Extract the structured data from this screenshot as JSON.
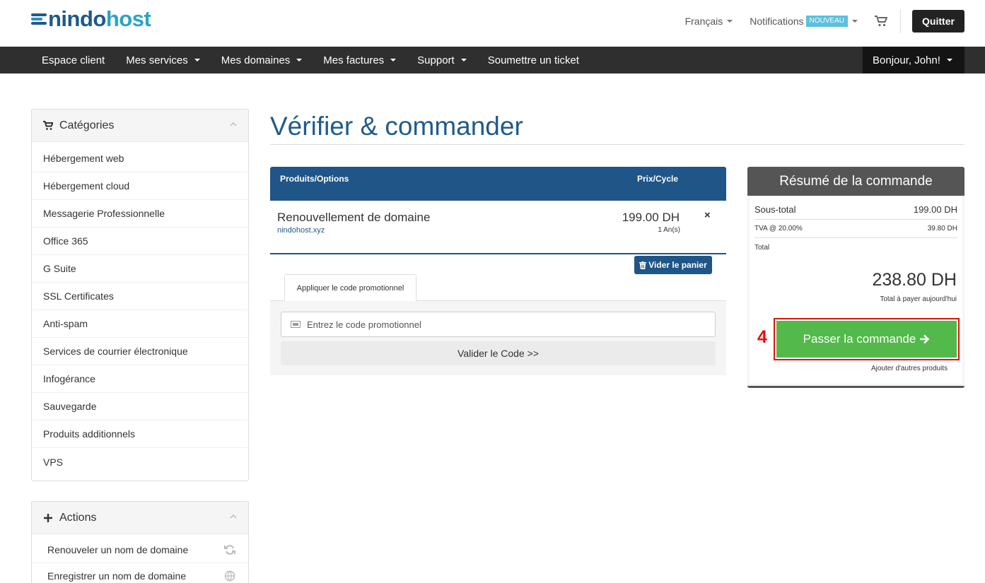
{
  "brand": {
    "name_part1": "nindo",
    "name_part2": "host"
  },
  "topbar": {
    "language": "Français",
    "notifications": "Notifications",
    "notifications_badge": "NOUVEAU",
    "quit": "Quitter"
  },
  "nav": {
    "items": [
      "Espace client",
      "Mes services",
      "Mes domaines",
      "Mes factures",
      "Support",
      "Soumettre un ticket"
    ],
    "user": "Bonjour, John!"
  },
  "sidebar": {
    "categories_title": "Catégories",
    "categories": [
      "Hébergement web",
      "Hébergement cloud",
      "Messagerie Professionnelle",
      "Office 365",
      "G Suite",
      "SSL Certificates",
      "Anti-spam",
      "Services de courrier électronique",
      "Infogérance",
      "Sauvegarde",
      "Produits additionnels",
      "VPS"
    ],
    "actions_title": "Actions",
    "actions": [
      "Renouveler un nom de domaine",
      "Enregistrer un nom de domaine"
    ]
  },
  "main": {
    "title": "Vérifier & commander",
    "cart": {
      "col_products": "Produits/Options",
      "col_price": "Prix/Cycle",
      "item_name": "Renouvellement de domaine",
      "item_domain": "nindohost.xyz",
      "item_price": "199.00 DH",
      "item_cycle": "1 An(s)",
      "remove": "×",
      "empty_cart": "Vider le panier"
    },
    "promo": {
      "tab": "Appliquer le code promotionnel",
      "placeholder": "Entrez le code promotionnel",
      "validate": "Valider le Code >>"
    }
  },
  "summary": {
    "title": "Résumé de la commande",
    "subtotal_label": "Sous-total",
    "subtotal_value": "199.00 DH",
    "tax_label": "TVA @ 20.00%",
    "tax_value": "39.80 DH",
    "total_label": "Total",
    "total_value": "238.80 DH",
    "total_caption": "Total à payer aujourd'hui",
    "step_number": "4",
    "checkout": "Passer la commande",
    "add_more": "Ajouter d'autres produits"
  },
  "colors": {
    "primary": "#1f5587",
    "success": "#52b94a",
    "highlight": "#e0120e",
    "navbar": "#2f2f2f"
  }
}
